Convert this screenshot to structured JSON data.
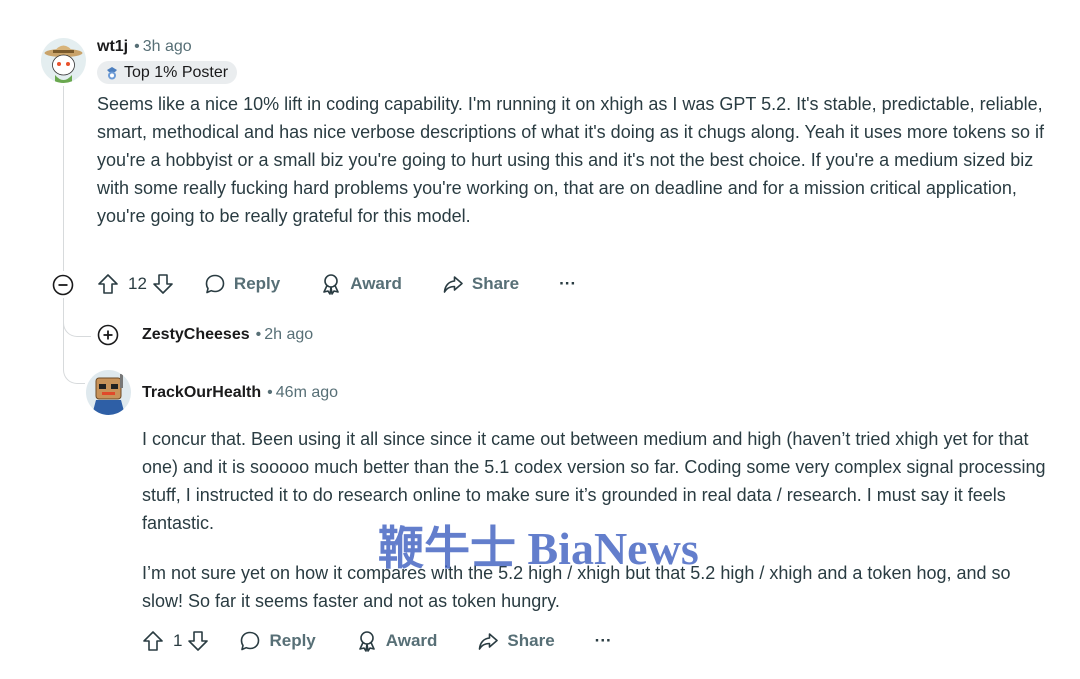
{
  "comments": [
    {
      "author": "wt1j",
      "time": "3h ago",
      "flair": "Top 1% Poster",
      "body": "Seems like a nice 10% lift in coding capability. I'm running it on xhigh as I was GPT 5.2. It's stable, predictable, reliable, smart, methodical and has nice verbose descriptions of what it's doing as it chugs along. Yeah it uses more tokens so if you're a hobbyist or a small biz you're going to hurt using this and it's not the best choice. If you're a medium sized biz with some really fucking hard problems you're working on, that are on deadline and for a mission critical application, you're going to be really grateful for this model.",
      "score": "12",
      "reply_label": "Reply",
      "award_label": "Award",
      "share_label": "Share",
      "more_label": "···"
    },
    {
      "author": "ZestyCheeses",
      "time": "2h ago",
      "collapsed": true
    },
    {
      "author": "TrackOurHealth",
      "time": "46m ago",
      "body_p1": "I concur that. Been using it all since since it came out between medium and high (haven’t tried xhigh yet for that one) and it is sooooo much better than the 5.1 codex version so far. Coding some very complex signal processing stuff, I instructed it to do research online to make sure it’s grounded in real data / research. I must say it feels fantastic.",
      "body_p2": "I’m not sure yet on how it compares with the 5.2 high / xhigh but that 5.2 high / xhigh and a token hog, and so slow! So far it seems faster and not as token hungry.",
      "score": "1",
      "reply_label": "Reply",
      "award_label": "Award",
      "share_label": "Share",
      "more_label": "···"
    }
  ],
  "watermark": "鞭牛士 BiaNews",
  "icons": {
    "upvote": "upvote-arrow-icon",
    "downvote": "downvote-arrow-icon",
    "reply": "speech-bubble-icon",
    "award": "award-ribbon-icon",
    "share": "share-arrow-icon",
    "collapse": "minus-circle-icon",
    "expand": "plus-circle-icon"
  },
  "colors": {
    "text": "#2a3c42",
    "meta": "#576f76",
    "thread_line": "#d7dadc",
    "flair_bg": "#eaedef"
  }
}
